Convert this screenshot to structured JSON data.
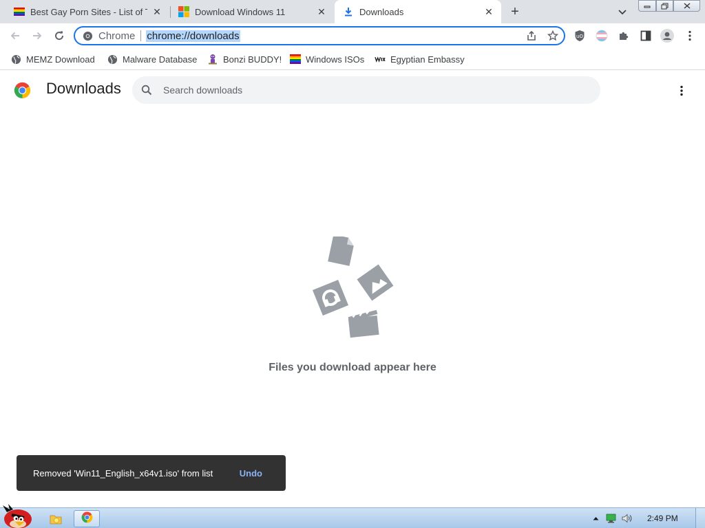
{
  "tabs": [
    {
      "title": "Best Gay Porn Sites - List of To",
      "favicon": "rainbow-flag-icon",
      "active": false
    },
    {
      "title": "Download Windows 11",
      "favicon": "windows-logo-icon",
      "active": false
    },
    {
      "title": "Downloads",
      "favicon": "download-arrow-icon",
      "active": true
    }
  ],
  "tab_close_glyph": "✕",
  "new_tab_glyph": "+",
  "omnibox": {
    "chip": "Chrome",
    "url": "chrome://downloads"
  },
  "bookmarks": [
    {
      "label": "MEMZ Download",
      "icon": "globe-icon"
    },
    {
      "label": "Malware Database",
      "icon": "globe-icon"
    },
    {
      "label": "Bonzi BUDDY!",
      "icon": "bonzi-icon"
    },
    {
      "label": "Windows ISOs",
      "icon": "rainbow-flag-icon"
    },
    {
      "label": "Egyptian Embassy",
      "icon": "wix-icon"
    }
  ],
  "page": {
    "title": "Downloads",
    "search_placeholder": "Search downloads",
    "empty_message": "Files you download appear here"
  },
  "toast": {
    "message": "Removed 'Win11_English_x64v1.iso' from list",
    "action": "Undo"
  },
  "taskbar": {
    "clock": "2:49 PM"
  },
  "colors": {
    "accent": "#1a73e8",
    "tabstrip": "#dee1e6",
    "toast_bg": "#323232",
    "toast_action": "#8ab4f8",
    "illustration": "#9aa0a6"
  }
}
